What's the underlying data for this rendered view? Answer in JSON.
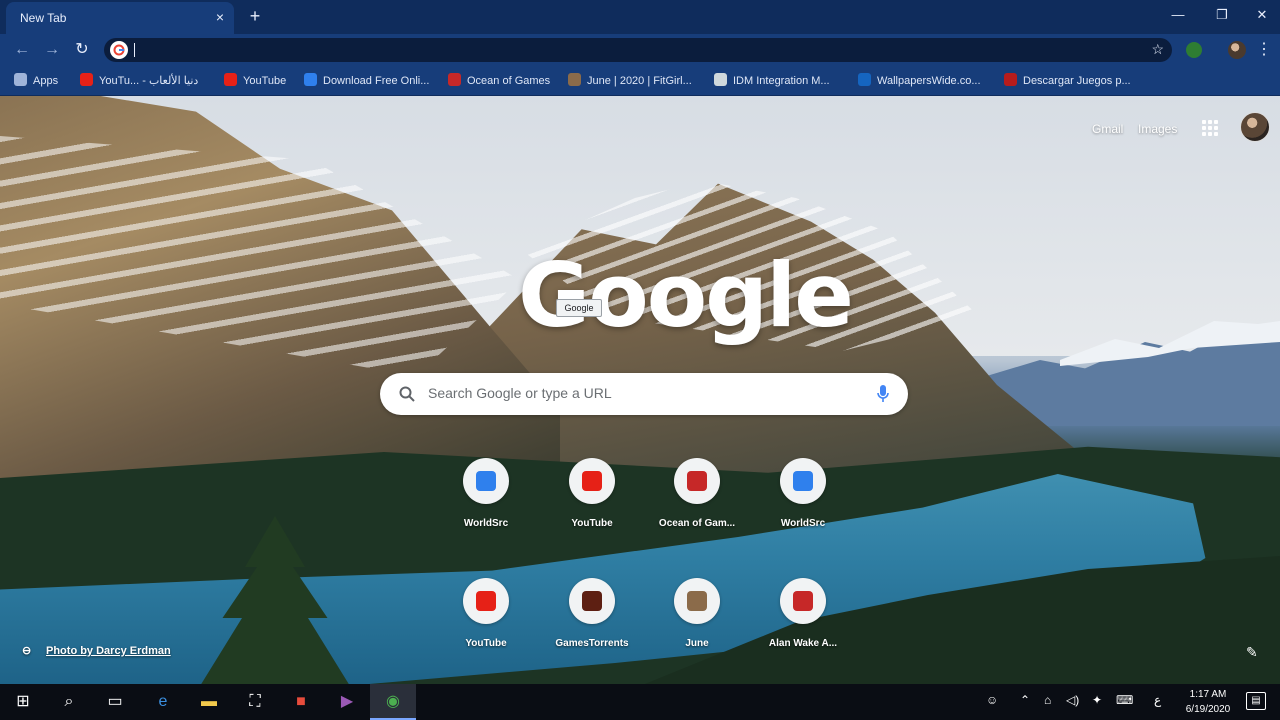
{
  "browser": {
    "tab_title": "New Tab",
    "tab_close": "×",
    "new_tab": "+",
    "window_controls": {
      "minimize": "—",
      "maximize": "❐",
      "close": "✕"
    }
  },
  "toolbar": {
    "back": "←",
    "forward": "→",
    "reload": "↻",
    "omnibox_value": "",
    "bookmark_star": "☆"
  },
  "bookmarks": [
    {
      "label": "Apps",
      "icon": "apps-grid-icon",
      "color": "#9fb4d9"
    },
    {
      "label": "YouTu... - دنيا الألعاب",
      "icon": "youtube-icon",
      "color": "#e62117"
    },
    {
      "label": "YouTube",
      "icon": "youtube-icon",
      "color": "#e62117"
    },
    {
      "label": "Download Free Onli...",
      "icon": "worldsrc-icon",
      "color": "#2f80ed"
    },
    {
      "label": "Ocean of Games",
      "icon": "gamepad-icon",
      "color": "#c62828"
    },
    {
      "label": "June | 2020 | FitGirl...",
      "icon": "fitgirl-icon",
      "color": "#8b6b4a"
    },
    {
      "label": "IDM Integration M...",
      "icon": "idm-icon",
      "color": "#cfd8dc"
    },
    {
      "label": "WallpapersWide.co...",
      "icon": "wallpaper-icon",
      "color": "#1565c0"
    },
    {
      "label": "Descargar Juegos p...",
      "icon": "descargar-icon",
      "color": "#b71c1c"
    }
  ],
  "ntp": {
    "gmail": "Gmail",
    "images": "Images",
    "logo_text": "Google",
    "logo_tooltip": "Google",
    "search_placeholder": "Search Google or type a URL",
    "shortcuts_row1": [
      {
        "label": "WorldSrc",
        "icon": "worldsrc-icon",
        "color": "#2f80ed"
      },
      {
        "label": "YouTube",
        "icon": "youtube-icon",
        "color": "#e62117"
      },
      {
        "label": "Ocean of Gam...",
        "icon": "gamepad-icon",
        "color": "#c62828"
      },
      {
        "label": "WorldSrc",
        "icon": "worldsrc-icon",
        "color": "#2f80ed"
      }
    ],
    "shortcuts_row2": [
      {
        "label": "YouTube",
        "icon": "youtube-icon",
        "color": "#e62117"
      },
      {
        "label": "GamesTorrents",
        "icon": "gamestorrents-icon",
        "color": "#5d1f12"
      },
      {
        "label": "June",
        "icon": "fitgirl-icon",
        "color": "#8b6b4a"
      },
      {
        "label": "Alan Wake A...",
        "icon": "gamepad-icon",
        "color": "#c62828"
      }
    ],
    "photo_credit": "Photo by Darcy Erdman"
  },
  "taskbar": {
    "clock_time": "1:17 AM",
    "clock_date": "6/19/2020",
    "lang": "ع"
  }
}
